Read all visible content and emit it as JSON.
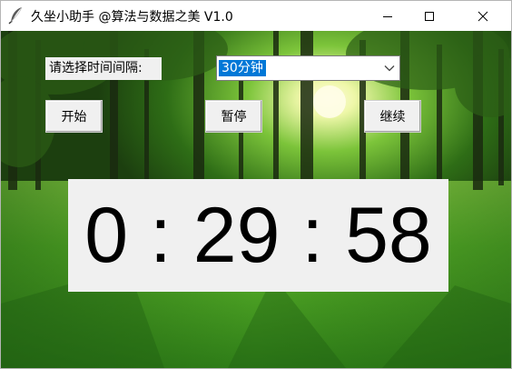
{
  "window": {
    "title": "久坐小助手 @算法与数据之美 V1.0",
    "icon": "feather-icon",
    "controls": [
      "minimize-icon",
      "maximize-icon",
      "close-icon"
    ]
  },
  "form": {
    "interval_label": "请选择时间间隔:",
    "interval_selected": "30分钟"
  },
  "buttons": {
    "start": "开始",
    "pause": "暂停",
    "continue": "继续"
  },
  "timer": {
    "display": "0 : 29 : 58",
    "hours": "0",
    "minutes": "29",
    "seconds": "58"
  },
  "background": {
    "scene": "forest-sunlight-image",
    "colors": {
      "sky_light": "#fffce0",
      "forest_dark": "#1f4a12",
      "grass": "#4aa523",
      "selection_accent": "#0078d7"
    }
  }
}
